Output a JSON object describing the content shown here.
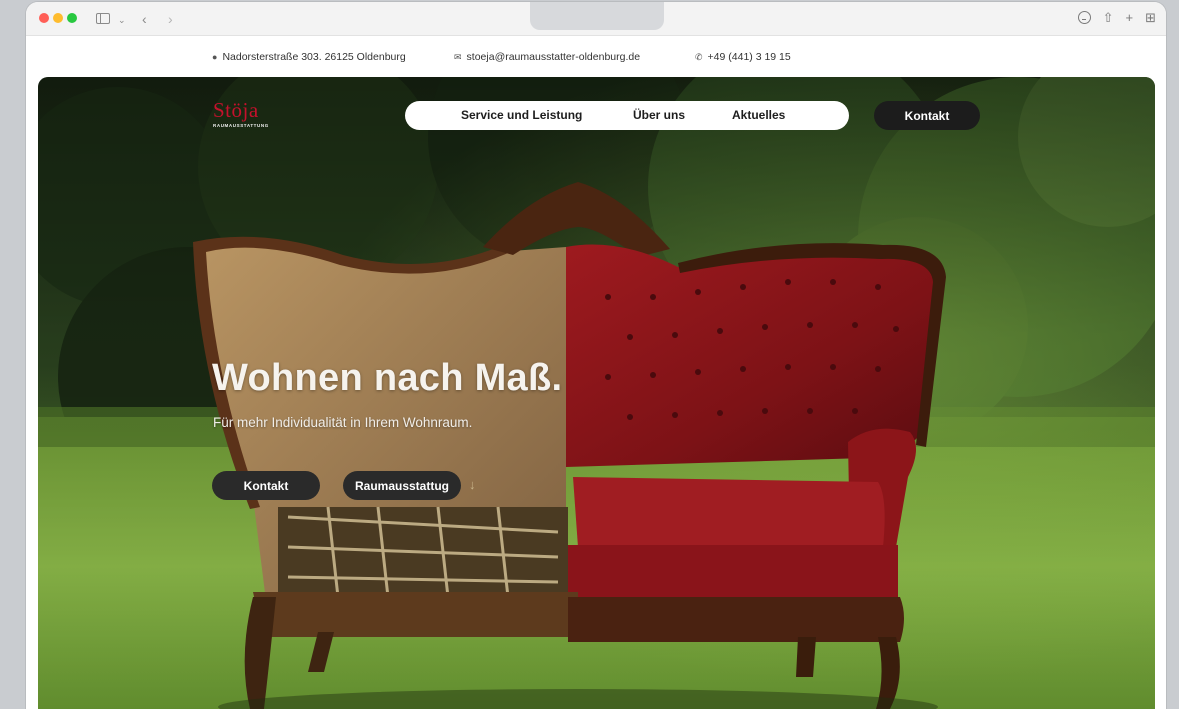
{
  "browser": {
    "toolbar_icons": [
      "sidebar-icon",
      "chevron-down-icon",
      "back-icon",
      "forward-icon",
      "download-icon",
      "share-icon",
      "new-tab-icon",
      "tab-overview-icon"
    ]
  },
  "infobar": {
    "address": "Nadorsterstraße 303. 26125 Oldenburg",
    "email": "stoeja@raumausstatter-oldenburg.de",
    "phone": "+49 (441) 3 19 15"
  },
  "header": {
    "logo_text": "Stöja",
    "logo_sub": "RAUMAUSSTATTUNG",
    "nav": [
      "Service und Leistung",
      "Über uns",
      "Aktuelles"
    ],
    "cta_label": "Kontakt"
  },
  "hero": {
    "headline": "Wohnen nach Maß.",
    "subline": "Für mehr Individualität in Ihrem Wohnraum.",
    "button_primary": "Kontakt",
    "button_secondary": "Raumausstattug"
  },
  "colors": {
    "brand_red": "#c4112c",
    "button_dark": "#2a2a2a",
    "nav_bg": "#ffffff"
  }
}
